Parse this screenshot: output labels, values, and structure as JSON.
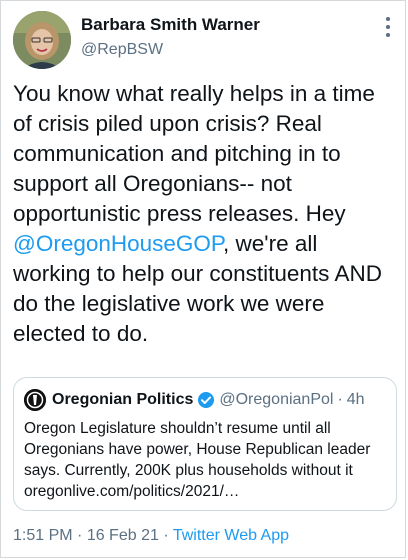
{
  "author": {
    "name": "Barbara Smith Warner",
    "handle": "@RepBSW"
  },
  "tweet": {
    "text_before_mention": "You know what really helps in a time of crisis piled upon crisis? Real communication and pitching in to support all Oregonians-- not opportunistic press releases. Hey ",
    "mention": "@OregonHouseGOP",
    "text_after_mention": ", we're all working to help our constituents AND do the legislative work we were elected to do."
  },
  "quote": {
    "name": "Oregonian Politics",
    "handle": "@OregonianPol",
    "separator": "·",
    "time": "4h",
    "text": "Oregon Legislature shouldn’t resume until all Oregonians have power, House Republican leader says. Currently, 200K plus households without it oregonlive.com/politics/2021/…"
  },
  "meta": {
    "time": "1:51 PM",
    "sep1": " · ",
    "date": "16 Feb 21",
    "sep2": " · ",
    "source": "Twitter Web App"
  },
  "icons": {
    "more": "more-vertical-icon",
    "verified": "verified-badge-icon",
    "accent": "#1d9bf0"
  }
}
